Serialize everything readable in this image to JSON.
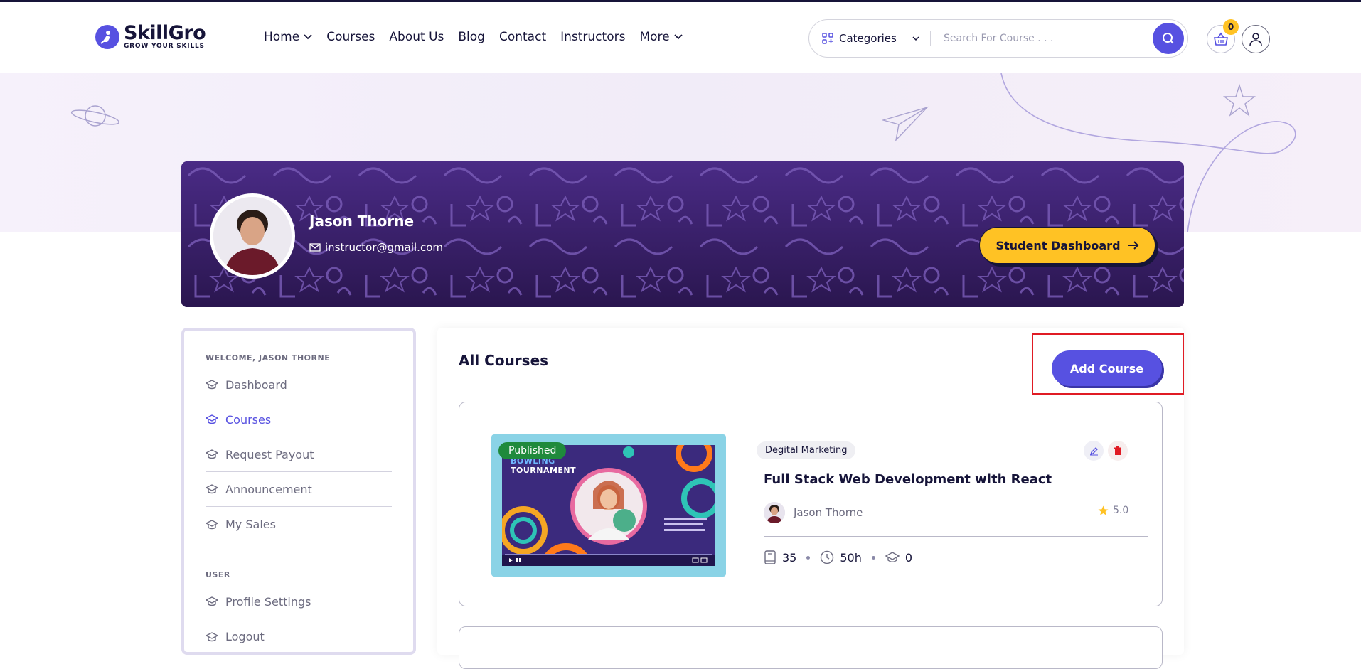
{
  "brand": {
    "name": "SkillGro",
    "tagline": "GROW YOUR SKILLS"
  },
  "nav": [
    {
      "label": "Home",
      "dropdown": true
    },
    {
      "label": "Courses",
      "dropdown": false
    },
    {
      "label": "About Us",
      "dropdown": false
    },
    {
      "label": "Blog",
      "dropdown": false
    },
    {
      "label": "Contact",
      "dropdown": false
    },
    {
      "label": "Instructors",
      "dropdown": false
    },
    {
      "label": "More",
      "dropdown": true
    }
  ],
  "search": {
    "category_label": "Categories",
    "placeholder": "Search For Course . . ."
  },
  "cart": {
    "count": "0"
  },
  "profile": {
    "name": "Jason Thorne",
    "email": "instructor@gmail.com",
    "dashboard_button": "Student Dashboard"
  },
  "sidebar": {
    "welcome": "WELCOME, JASON THORNE",
    "items": [
      {
        "label": "Dashboard",
        "active": false
      },
      {
        "label": "Courses",
        "active": true
      },
      {
        "label": "Request Payout",
        "active": false
      },
      {
        "label": "Announcement",
        "active": false
      },
      {
        "label": "My Sales",
        "active": false
      }
    ],
    "user_title": "USER",
    "user_items": [
      {
        "label": "Profile Settings"
      },
      {
        "label": "Logout"
      }
    ]
  },
  "main": {
    "title": "All Courses",
    "add_button": "Add Course",
    "course": {
      "status": "Published",
      "category": "Degital Marketing",
      "title": "Full Stack Web Development with React",
      "author": "Jason Thorne",
      "rating": "5.0",
      "lessons": "35",
      "duration": "50h",
      "students": "0",
      "thumb_lines": [
        "BOWLING",
        "TOURNAMENT"
      ]
    }
  },
  "colors": {
    "primary": "#5751e1",
    "accent": "#ffc224",
    "dark": "#161439",
    "published": "#1f8a3c"
  }
}
